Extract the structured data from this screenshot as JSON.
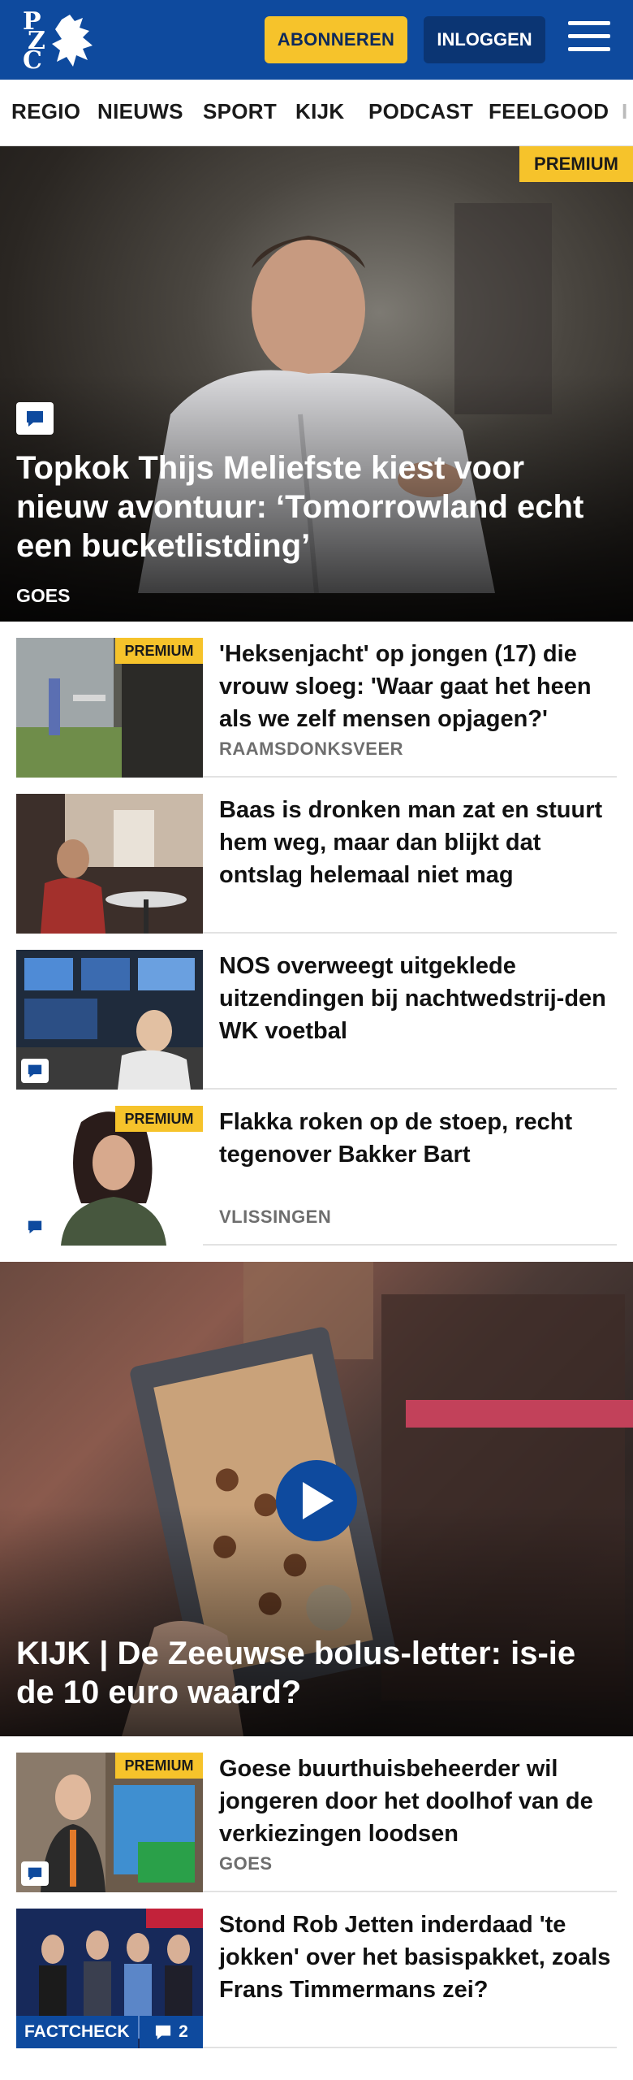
{
  "header": {
    "logo_letters": [
      "P",
      "Z",
      "C"
    ],
    "subscribe_label": "ABONNEREN",
    "login_label": "INLOGGEN",
    "menu_icon": "hamburger-menu-icon",
    "colors": {
      "brand_blue": "#0e4a9e",
      "subscribe_yellow": "#f6c32b",
      "login_navy": "#0b3573"
    }
  },
  "nav": {
    "items": [
      "REGIO",
      "NIEUWS",
      "SPORT",
      "KIJK",
      "PODCAST",
      "FEELGOOD",
      "I"
    ]
  },
  "hero": {
    "badge": "PREMIUM",
    "comment_icon": "comment-icon",
    "title": "Topkok Thijs Meliefste kiest voor nieuw avontuur: ‘Tomorrowland echt een bucketlistding’",
    "location": "GOES"
  },
  "articles": [
    {
      "badge": "PREMIUM",
      "title": "'Heksenjacht' op jongen (17) die vrouw sloeg: 'Waar gaat het heen als we zelf mensen opjagen?'",
      "location": "RAAMSDONKSVEER"
    },
    {
      "badge": "",
      "title": "Baas is dronken man zat en stuurt hem weg, maar dan blijkt dat ontslag helemaal niet mag",
      "location": ""
    },
    {
      "badge": "",
      "title": "NOS overweegt uitgeklede uitzendingen bij nachtwedstrij-den WK voetbal",
      "location": ""
    },
    {
      "badge": "PREMIUM",
      "title": "Flakka roken op de stoep, recht tegenover Bakker Bart",
      "location": "VLISSINGEN"
    }
  ],
  "video": {
    "play_icon": "play-icon",
    "title": "KIJK | De Zeeuwse bolus-letter: is-ie de 10 euro waard?"
  },
  "articles_bottom": [
    {
      "badge": "PREMIUM",
      "title": "Goese buurthuisbeheerder wil jongeren door het doolhof van de verkiezingen loodsen",
      "location": "GOES"
    },
    {
      "badge": "",
      "title": "Stond Rob Jetten inderdaad 'te jokken' over het basispakket, zoals Frans Timmermans zei?",
      "location": "",
      "factcheck_label": "FACTCHECK",
      "comment_count": "2"
    }
  ]
}
